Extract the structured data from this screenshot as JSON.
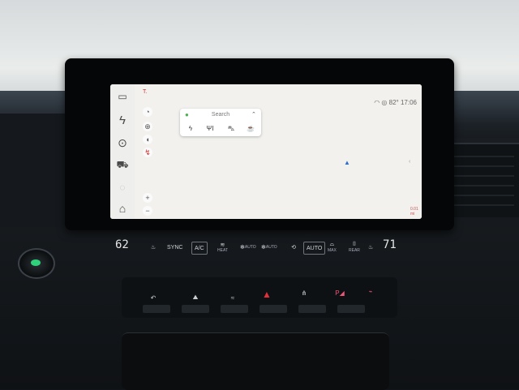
{
  "screen": {
    "sidebar": {
      "items": [
        {
          "icon": "camera-icon",
          "glyph": "▭"
        },
        {
          "icon": "charging-icon",
          "glyph": "ϟ"
        },
        {
          "icon": "navigation-pin-icon",
          "glyph": "⊙"
        },
        {
          "icon": "vehicle-icon",
          "glyph": "⛟"
        },
        {
          "icon": "media-icon",
          "glyph": "◌"
        },
        {
          "icon": "home-icon",
          "glyph": "⌂"
        }
      ]
    },
    "app_label": "T.",
    "status": {
      "temperature": "82°",
      "time": "17:06"
    },
    "search": {
      "placeholder": "Search",
      "categories": [
        {
          "icon": "charging-station-icon",
          "glyph": "ϟ"
        },
        {
          "icon": "restaurant-icon",
          "glyph": "ΨΙ"
        },
        {
          "icon": "shopping-icon",
          "glyph": "⛍"
        },
        {
          "icon": "coffee-icon",
          "glyph": "☕"
        }
      ]
    },
    "map_controls": {
      "zoom_in": "+",
      "zoom_out": "−"
    },
    "map_scale": "0.01 mi"
  },
  "climate": {
    "driver_temp": "62",
    "passenger_temp": "71",
    "buttons": {
      "sync": "SYNC",
      "ac": "A/C",
      "heat": "HEAT",
      "auto_fan": "AUTO",
      "recirc_auto": "AUTO",
      "max": "MAX",
      "rear": "REAR"
    }
  }
}
